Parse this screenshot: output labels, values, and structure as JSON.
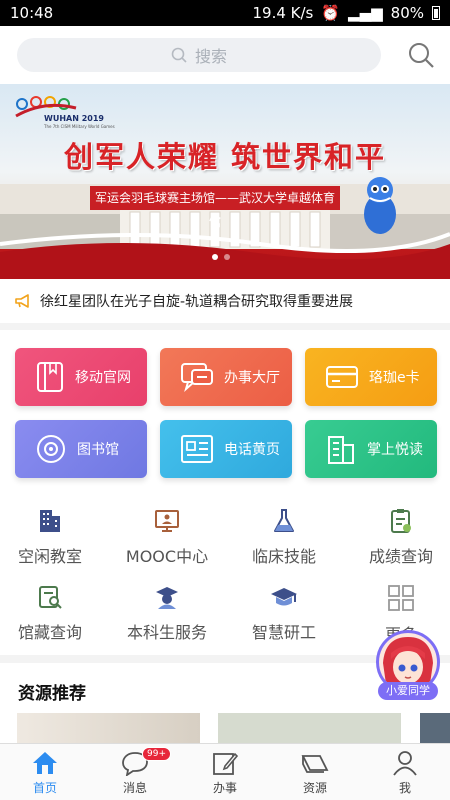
{
  "status": {
    "time": "10:48",
    "speed": "19.4 K/s",
    "battery": "80%"
  },
  "search": {
    "placeholder": "搜索"
  },
  "banner": {
    "logo_year": "WUHAN 2019",
    "logo_sub": "The 7th CISM Military World Games",
    "slogan": "创军人荣耀 筑世界和平",
    "venue": "军运会羽毛球赛主场馆——武汉大学卓越体育馆"
  },
  "news": {
    "text": "徐红星团队在光子自旋-轨道耦合研究取得重要进展"
  },
  "tiles": [
    {
      "label": "移动官网",
      "icon": "book-icon",
      "color": "#ef4f78"
    },
    {
      "label": "办事大厅",
      "icon": "chat-icon",
      "color": "#ef6a50"
    },
    {
      "label": "珞珈e卡",
      "icon": "card-icon",
      "color": "#f7a719"
    },
    {
      "label": "图书馆",
      "icon": "disc-icon",
      "color": "#7c83ea"
    },
    {
      "label": "电话黄页",
      "icon": "document-icon",
      "color": "#38b6e6"
    },
    {
      "label": "掌上悦读",
      "icon": "buildings-icon",
      "color": "#2fc58a"
    }
  ],
  "grid": [
    {
      "label": "空闲教室",
      "icon": "classroom-icon"
    },
    {
      "label": "MOOC中心",
      "icon": "mooc-icon"
    },
    {
      "label": "临床技能",
      "icon": "flask-icon"
    },
    {
      "label": "成绩查询",
      "icon": "grades-icon"
    },
    {
      "label": "馆藏查询",
      "icon": "catalog-search-icon"
    },
    {
      "label": "本科生服务",
      "icon": "student-icon"
    },
    {
      "label": "智慧研工",
      "icon": "graduation-cap-icon"
    },
    {
      "label": "更多",
      "icon": "more-grid-icon"
    }
  ],
  "assistant": {
    "label": "小爱同学"
  },
  "section": {
    "title": "资源推荐"
  },
  "tabs": [
    {
      "label": "首页",
      "icon": "home-icon",
      "active": true
    },
    {
      "label": "消息",
      "icon": "message-icon",
      "badge": "99+"
    },
    {
      "label": "办事",
      "icon": "edit-icon"
    },
    {
      "label": "资源",
      "icon": "resources-icon"
    },
    {
      "label": "我",
      "icon": "user-icon"
    }
  ]
}
